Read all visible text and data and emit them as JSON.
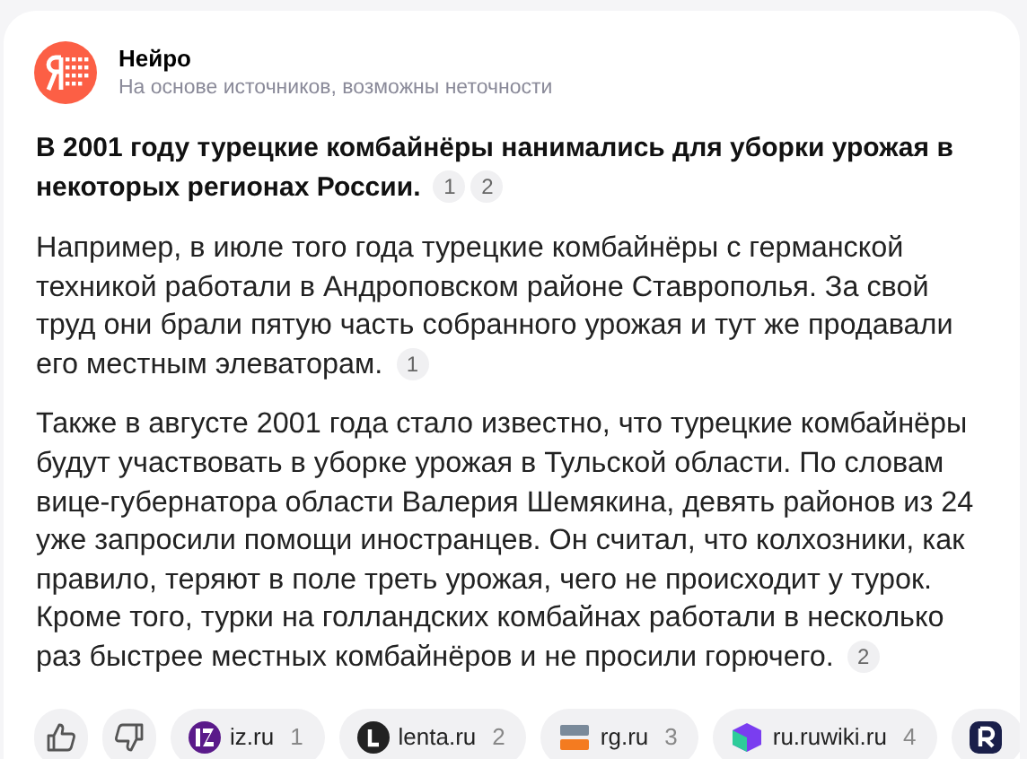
{
  "header": {
    "title": "Нейро",
    "subtitle": "На основе источников, возможны неточности"
  },
  "heading": {
    "text": "В 2001 году турецкие комбайнёры нанимались для уборки урожая в некоторых регионах России.",
    "citations": [
      "1",
      "2"
    ]
  },
  "paragraphs": [
    {
      "text": "Например, в июле того года турецкие комбайнёры с германской техникой работали в Андроповском районе Ставрополья. За свой труд они брали пятую часть собранного урожая и тут же продавали его местным элеваторам.",
      "citations": [
        "1"
      ]
    },
    {
      "text": "Также в августе 2001 года стало известно, что турецкие комбайнёры будут участвовать в уборке урожая в Тульской области. По словам вице-губернатора области Валерия Шемякина, девять районов из 24 уже запросили помощи иностранцев. Он считал, что колхозники, как правило, теряют в поле треть урожая, чего не происходит у турок. Кроме того, турки на голландских комбайнах работали в несколько раз быстрее местных комбайнёров и не просили горючего.",
      "citations": [
        "2"
      ]
    }
  ],
  "sources": [
    {
      "kind": "iz",
      "domain": "iz.ru",
      "count": "1"
    },
    {
      "kind": "lenta",
      "domain": "lenta.ru",
      "count": "2"
    },
    {
      "kind": "rg",
      "domain": "rg.ru",
      "count": "3"
    },
    {
      "kind": "ruwiki",
      "domain": "ru.ruwiki.ru",
      "count": "4"
    },
    {
      "kind": "r"
    }
  ]
}
